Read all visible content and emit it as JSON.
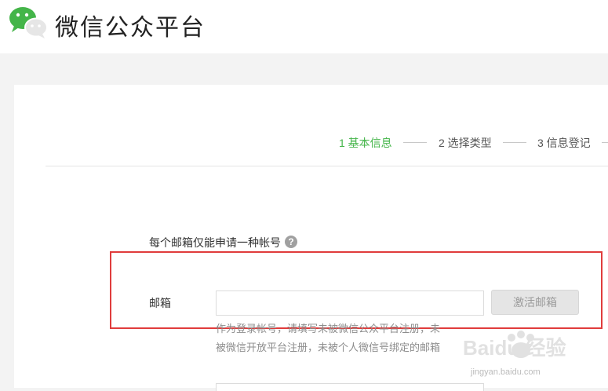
{
  "header": {
    "brand": "微信公众平台",
    "logo_icon": "wechat-logo-icon"
  },
  "steps": [
    {
      "label": "1 基本信息",
      "active": true
    },
    {
      "label": "2 选择类型",
      "active": false
    },
    {
      "label": "3 信息登记",
      "active": false
    }
  ],
  "form": {
    "notice": "每个邮箱仅能申请一种帐号",
    "help_icon": "question-icon",
    "help_glyph": "?",
    "email_label": "邮箱",
    "email_value": "",
    "email_placeholder": "",
    "activate_label": "激活邮箱",
    "hint_line1": "作为登录帐号，请填写未被微信公众平台注册，未",
    "hint_line2": "被微信开放平台注册，未被个人微信号绑定的邮箱"
  },
  "watermark": {
    "text": "jingyan.baidu.com",
    "brand_text": "Baidu 经验"
  },
  "colors": {
    "accent_green": "#44b549",
    "highlight_red": "#e03c3c"
  }
}
